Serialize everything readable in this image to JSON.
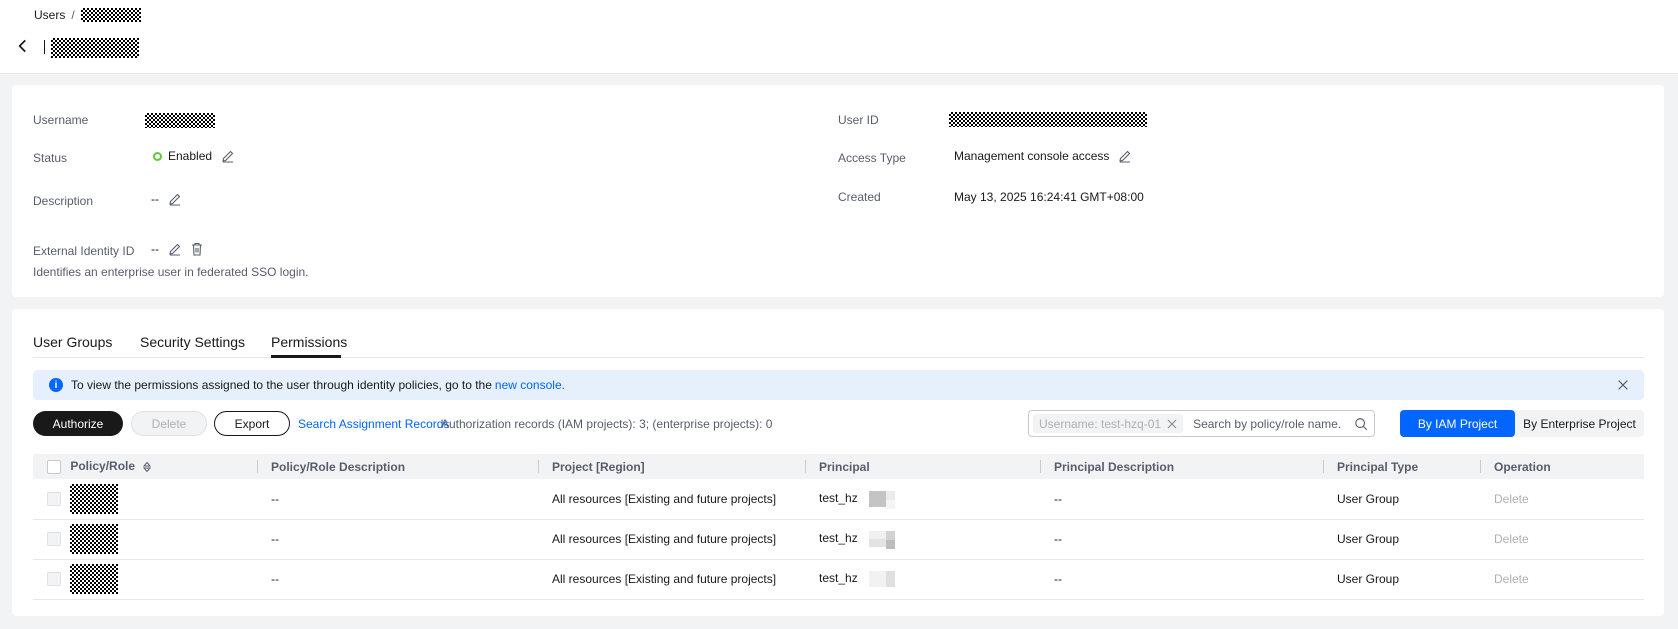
{
  "breadcrumb": {
    "parent": "Users",
    "separator": "/"
  },
  "fields": {
    "username_label": "Username",
    "status_label": "Status",
    "status_value": "Enabled",
    "description_label": "Description",
    "description_value": "--",
    "external_id_label": "External Identity ID",
    "external_id_value": "--",
    "external_id_hint": "Identifies an enterprise user in federated SSO login.",
    "user_id_label": "User ID",
    "access_type_label": "Access Type",
    "access_type_value": "Management console access",
    "created_label": "Created",
    "created_value": "May 13, 2025 16:24:41 GMT+08:00"
  },
  "tabs": [
    {
      "label": "User Groups"
    },
    {
      "label": "Security Settings"
    },
    {
      "label": "Permissions"
    }
  ],
  "alert": {
    "text": "To view the permissions assigned to the user through identity policies, go to the",
    "link": "new console."
  },
  "toolbar": {
    "authorize": "Authorize",
    "delete": "Delete",
    "export": "Export",
    "search_records": "Search Assignment Records",
    "records_text": "Authorization records (IAM projects): 3; (enterprise projects): 0",
    "filter_chip": "Username: test-hzq-01",
    "search_placeholder": "Search by policy/role name.",
    "by_iam": "By IAM Project",
    "by_enterprise": "By Enterprise Project"
  },
  "table": {
    "headers": [
      "Policy/Role",
      "Policy/Role Description",
      "Project [Region]",
      "Principal",
      "Principal Description",
      "Principal Type",
      "Operation"
    ],
    "rows": [
      {
        "description": "--",
        "project": "All resources [Existing and future projects]",
        "principal": "test_hz",
        "principal_description": "--",
        "principal_type": "User Group",
        "operation": "Delete"
      },
      {
        "description": "--",
        "project": "All resources [Existing and future projects]",
        "principal": "test_hz",
        "principal_description": "--",
        "principal_type": "User Group",
        "operation": "Delete"
      },
      {
        "description": "--",
        "project": "All resources [Existing and future projects]",
        "principal": "test_hz",
        "principal_description": "--",
        "principal_type": "User Group",
        "operation": "Delete"
      }
    ]
  },
  "colors": {
    "primary": "#0066ff",
    "dark": "#191919",
    "status_enabled": "#5fc53a",
    "alert_bg": "#e6f0fd"
  },
  "icons": [
    "chevron-left-icon",
    "edit-icon",
    "delete-icon",
    "info-icon",
    "close-icon",
    "search-icon",
    "sort-icon"
  ]
}
